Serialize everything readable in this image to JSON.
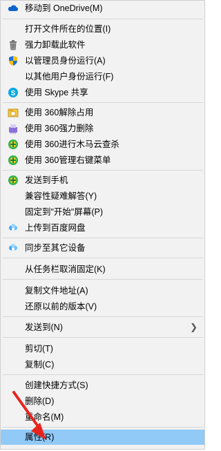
{
  "menu": {
    "items": [
      {
        "label": "移动到 OneDrive(M)",
        "icon": "onedrive-cloud-icon"
      },
      {
        "label": "打开文件所在的位置(I)",
        "icon": ""
      },
      {
        "label": "强力卸载此软件",
        "icon": "uninstall-trash-icon"
      },
      {
        "label": "以管理员身份运行(A)",
        "icon": "admin-shield-icon"
      },
      {
        "label": "以其他用户身份运行(F)",
        "icon": ""
      },
      {
        "label": "使用 Skype 共享",
        "icon": "skype-icon"
      },
      {
        "label": "使用 360解除占用",
        "icon": "360-unlock-icon"
      },
      {
        "label": "使用 360强力删除",
        "icon": "360-shred-icon"
      },
      {
        "label": "使用 360进行木马云查杀",
        "icon": "360-antivirus-icon"
      },
      {
        "label": "使用 360管理右键菜单",
        "icon": "360-antivirus-icon"
      },
      {
        "label": "发送到手机",
        "icon": "360-antivirus-icon"
      },
      {
        "label": "兼容性疑难解答(Y)",
        "icon": ""
      },
      {
        "label": "固定到\"开始\"屏幕(P)",
        "icon": ""
      },
      {
        "label": "上传到百度网盘",
        "icon": "baidu-netdisk-icon"
      },
      {
        "label": "同步至其它设备",
        "icon": "baidu-netdisk-icon"
      },
      {
        "label": "从任务栏取消固定(K)",
        "icon": ""
      },
      {
        "label": "复制文件地址(A)",
        "icon": ""
      },
      {
        "label": "还原以前的版本(V)",
        "icon": ""
      },
      {
        "label": "发送到(N)",
        "icon": ""
      },
      {
        "label": "剪切(T)",
        "icon": ""
      },
      {
        "label": "复制(C)",
        "icon": ""
      },
      {
        "label": "创建快捷方式(S)",
        "icon": ""
      },
      {
        "label": "删除(D)",
        "icon": ""
      },
      {
        "label": "重命名(M)",
        "icon": ""
      },
      {
        "label": "属性(R)",
        "icon": ""
      }
    ],
    "submenu_chevron": "chevron-right-icon",
    "hover_color": "#91c9f7"
  },
  "annotation": {
    "arrow_color": "#e8231d",
    "arrow_icon": "red-arrow-icon"
  }
}
